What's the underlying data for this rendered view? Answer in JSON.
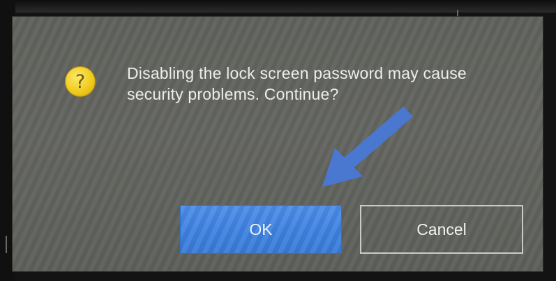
{
  "dialog": {
    "icon": "question-icon",
    "icon_glyph": "?",
    "message": "Disabling the lock screen password may cause security problems. Continue?",
    "ok_label": "OK",
    "cancel_label": "Cancel"
  },
  "annotation": {
    "icon": "arrow-pointer-icon",
    "color": "#4a78d0"
  },
  "colors": {
    "dialog_bg": "#61635e",
    "ok_button": "#3f83e2",
    "icon_yellow": "#f0cc1f",
    "text": "#eceeea"
  }
}
